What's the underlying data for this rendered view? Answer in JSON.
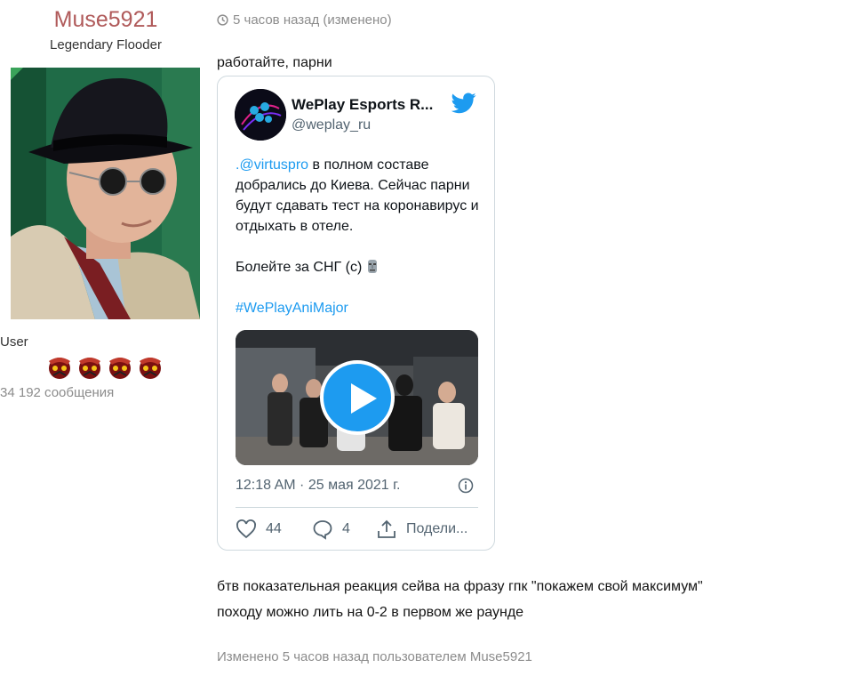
{
  "user": {
    "name": "Muse5921",
    "title": "Legendary Flooder",
    "role": "User",
    "message_count": "34 192 сообщения"
  },
  "post": {
    "time": "5 часов назад (изменено)",
    "line1": "работайте, парни",
    "line2_a": "бтв показательная реакция сейва на фразу гпк \"покажем свой максимум\"",
    "line2_b": "походу можно лить на 0-2 в первом же раунде",
    "edited_note": "Изменено 5 часов назад пользователем Muse5921"
  },
  "tweet": {
    "author_name": "WePlay Esports R...",
    "handle": "@weplay_ru",
    "mention": ".@virtuspro",
    "text_1": " в полном составе добрались до Киева. Сейчас парни будут сдавать тест на коронавирус и отдыхать в отеле.",
    "text_2": "Болейте за СНГ (с) ",
    "hashtag": "#WePlayAniMajor",
    "date": "12:18 AM · 25 мая 2021 г.",
    "likes": "44",
    "replies": "4",
    "share_label": "Подели..."
  },
  "colors": {
    "username": "#b05a5a",
    "twitter_blue": "#1d9bf0",
    "muted": "#8c8c8c"
  },
  "icons": [
    "clock-icon",
    "twitter-bird-icon",
    "info-icon",
    "heart-icon",
    "reply-bubble-icon",
    "share-icon",
    "play-icon",
    "moai-emoji-icon",
    "rank-icon"
  ]
}
